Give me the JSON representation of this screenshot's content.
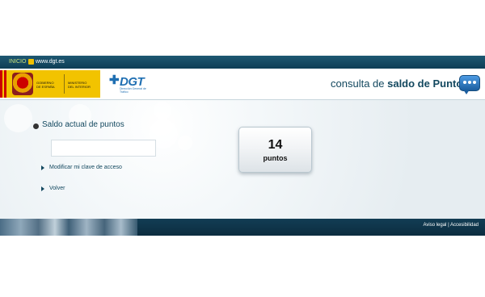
{
  "topbar": {
    "inicio_label": "INICIO",
    "site_label": "www.dgt.es"
  },
  "header": {
    "gov_line1": "GOBIERNO",
    "gov_line2": "DE ESPAÑA",
    "ministry_line1": "MINISTERIO",
    "ministry_line2": "DEL INTERIOR",
    "dgt_logo": "DGT",
    "dgt_subtitle": "Dirección General de Tráfico",
    "title_prefix": "consulta de ",
    "title_bold": "saldo de Puntos"
  },
  "main": {
    "section_title": "Saldo actual de puntos",
    "input_value": "",
    "links": {
      "modify_password": "Modificar mi clave de acceso",
      "back": "Volver"
    },
    "points": {
      "value": "14",
      "label": "puntos"
    }
  },
  "footer": {
    "legal_link": "Aviso legal",
    "separator": " | ",
    "accessibility_link": "Accesibilidad"
  },
  "colors": {
    "primary_dark": "#13485f",
    "topbar": "#1e5872",
    "footer": "#123d54",
    "gov_yellow": "#f2c300",
    "dgt_blue": "#1f6fb2"
  },
  "icons": {
    "topbar_arrow": "arrow-right-icon",
    "chat": "chat-icon",
    "bullet": "bullet-icon",
    "link_arrow": "triangle-right-icon"
  }
}
